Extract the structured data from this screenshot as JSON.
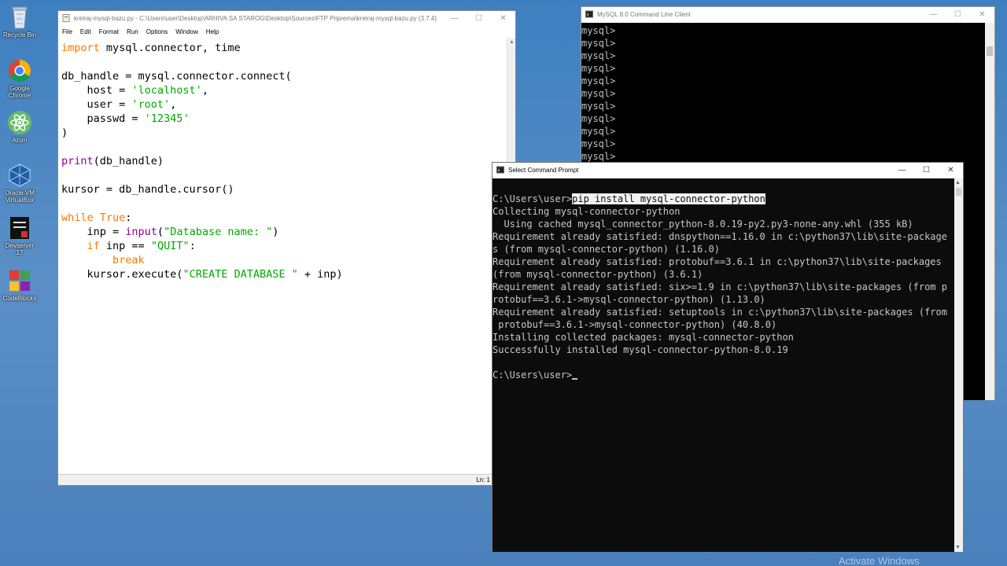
{
  "desktop": {
    "icons": [
      {
        "label": "Recycle Bin"
      },
      {
        "label": "Google Chrome"
      },
      {
        "label": "Atom"
      },
      {
        "label": "Oracle VM VirtualBox"
      },
      {
        "label": "Devserver 17"
      },
      {
        "label": "CodeBlocks"
      }
    ],
    "watermark": "Activate Windows"
  },
  "idle": {
    "title": "kreiraj-mysql-bazu.py - C:\\Users\\user\\Desktop\\ARHIVA SA STAROG\\Desktop\\Sources\\FTP Priprema\\kreiraj-mysql-bazu.py (3.7.4)",
    "menu": [
      "File",
      "Edit",
      "Format",
      "Run",
      "Options",
      "Window",
      "Help"
    ],
    "status": "Ln: 1"
  },
  "mysql": {
    "title": "MySQL 8.0 Command Line Client",
    "prompt": "mysql>",
    "prompt_lines": 11
  },
  "cmd": {
    "title": "Select Command Prompt",
    "prompt": "C:\\Users\\user>",
    "command": "pip install mysql-connector-python",
    "output": [
      "Collecting mysql-connector-python",
      "  Using cached mysql_connector_python-8.0.19-py2.py3-none-any.whl (355 kB)",
      "Requirement already satisfied: dnspython==1.16.0 in c:\\python37\\lib\\site-package",
      "s (from mysql-connector-python) (1.16.0)",
      "Requirement already satisfied: protobuf==3.6.1 in c:\\python37\\lib\\site-packages",
      "(from mysql-connector-python) (3.6.1)",
      "Requirement already satisfied: six>=1.9 in c:\\python37\\lib\\site-packages (from p",
      "rotobuf==3.6.1->mysql-connector-python) (1.13.0)",
      "Requirement already satisfied: setuptools in c:\\python37\\lib\\site-packages (from",
      " protobuf==3.6.1->mysql-connector-python) (40.8.0)",
      "Installing collected packages: mysql-connector-python",
      "Successfully installed mysql-connector-python-8.0.19",
      ""
    ],
    "final_prompt": "C:\\Users\\user>"
  }
}
